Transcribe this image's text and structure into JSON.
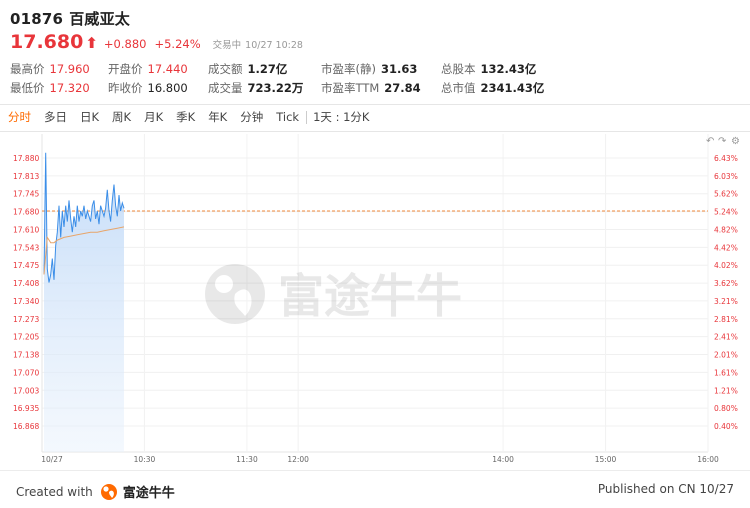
{
  "stock": {
    "code": "01876",
    "name": "百威亚太",
    "price": "17.680",
    "change": "+0.880",
    "change_pct": "+5.24%",
    "status": "交易中",
    "datetime": "10/27 10:28"
  },
  "stats": [
    {
      "label": "最高价",
      "value": "17.960"
    },
    {
      "label": "开盘价",
      "value": "17.440"
    },
    {
      "label": "成交额",
      "value": "1.27亿"
    },
    {
      "label": "市盈率(静)",
      "value": "31.63"
    },
    {
      "label": "总股本",
      "value": "132.43亿"
    },
    {
      "label": "最低价",
      "value": "17.320"
    },
    {
      "label": "昨收价",
      "value": "16.800"
    },
    {
      "label": "成交量",
      "value": "723.22万"
    },
    {
      "label": "市盈率TTM",
      "value": "27.84"
    },
    {
      "label": "总市值",
      "value": "2341.43亿"
    }
  ],
  "tabs": [
    "分时",
    "多日",
    "日K",
    "周K",
    "月K",
    "季K",
    "年K",
    "分钟",
    "Tick",
    "1天 : 1分K"
  ],
  "active_tab": "分时",
  "watermark": "富途牛牛",
  "footer": {
    "created_label": "Created with",
    "brand": "富途牛牛",
    "published": "Published on CN 10/27"
  },
  "colors": {
    "up": "#e8353a",
    "active_tab": "#ff6a00",
    "price_line": "#3b8ee8",
    "avg_line": "#e8a56a"
  },
  "chart_data": {
    "type": "line",
    "title": "",
    "y_ticks_left": [
      "17.880",
      "17.813",
      "17.745",
      "17.680",
      "17.610",
      "17.543",
      "17.475",
      "17.408",
      "17.340",
      "17.273",
      "17.205",
      "17.138",
      "17.070",
      "17.003",
      "16.935",
      "16.868"
    ],
    "y_ticks_right": [
      "6.43%",
      "6.03%",
      "5.62%",
      "5.24%",
      "4.82%",
      "4.42%",
      "4.02%",
      "3.62%",
      "3.21%",
      "2.81%",
      "2.41%",
      "2.01%",
      "1.61%",
      "1.21%",
      "0.80%",
      "0.40%"
    ],
    "x_ticks": [
      "10/27",
      "10:30",
      "11:30",
      "12:00",
      "14:00",
      "15:00",
      "16:00"
    ],
    "reference_price": 17.68,
    "ylim": [
      16.868,
      17.88
    ],
    "price_series": {
      "t": [
        0,
        1,
        2,
        3,
        4,
        5,
        6,
        7,
        8,
        9,
        10,
        11,
        12,
        13,
        14,
        15,
        16,
        17,
        18,
        19,
        20,
        21,
        22,
        23,
        24,
        25,
        26,
        27,
        28,
        29,
        30,
        31,
        32,
        33,
        34,
        35,
        36,
        37,
        38,
        39,
        40,
        41,
        42,
        43,
        44,
        45,
        46,
        47,
        48
      ],
      "price": [
        17.44,
        17.9,
        17.46,
        17.41,
        17.44,
        17.5,
        17.42,
        17.55,
        17.6,
        17.7,
        17.58,
        17.68,
        17.62,
        17.7,
        17.64,
        17.72,
        17.65,
        17.6,
        17.66,
        17.62,
        17.7,
        17.64,
        17.68,
        17.66,
        17.7,
        17.65,
        17.68,
        17.66,
        17.64,
        17.7,
        17.72,
        17.65,
        17.68,
        17.63,
        17.7,
        17.68,
        17.66,
        17.69,
        17.76,
        17.68,
        17.64,
        17.72,
        17.78,
        17.7,
        17.66,
        17.74,
        17.68,
        17.71,
        17.69
      ]
    },
    "avg_series": {
      "t": [
        0,
        2,
        4,
        6,
        8,
        12,
        16,
        20,
        24,
        28,
        32,
        36,
        40,
        44,
        48
      ],
      "price": [
        17.44,
        17.58,
        17.56,
        17.56,
        17.57,
        17.58,
        17.585,
        17.59,
        17.595,
        17.6,
        17.6,
        17.605,
        17.61,
        17.615,
        17.62
      ]
    }
  }
}
